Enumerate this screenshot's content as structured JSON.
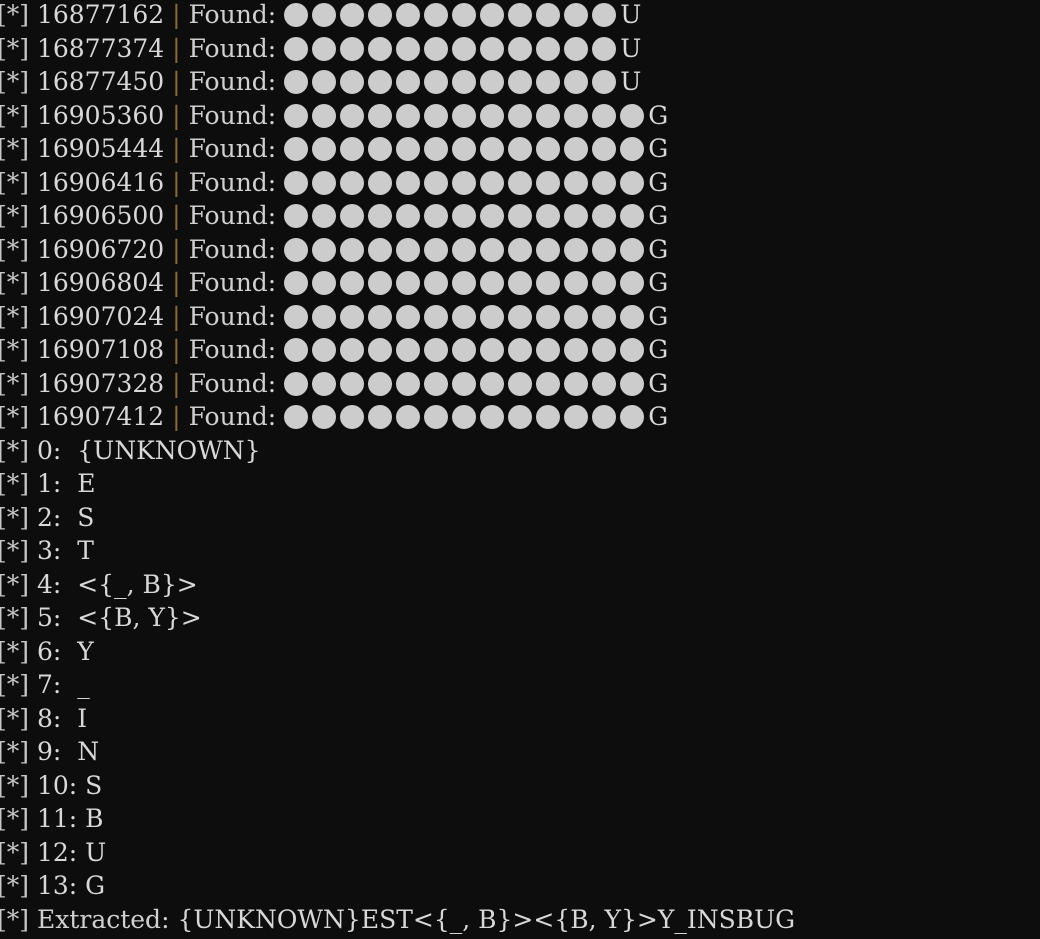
{
  "terminal": {
    "background_color": "#0d0d0d",
    "text_color": "#d4d4d4",
    "separator_color": "#8a6a3a",
    "circle_color": "#cccccc",
    "prefix": "[*]",
    "separator": "|",
    "found_label": "Found:",
    "extracted_label": "Extracted:"
  },
  "found_rows": [
    {
      "prefix": "[*]",
      "address": "16877162",
      "separator": "|",
      "label": "Found:",
      "circles": 12,
      "tail": "U"
    },
    {
      "prefix": "[*]",
      "address": "16877374",
      "separator": "|",
      "label": "Found:",
      "circles": 12,
      "tail": "U"
    },
    {
      "prefix": "[*]",
      "address": "16877450",
      "separator": "|",
      "label": "Found:",
      "circles": 12,
      "tail": "U"
    },
    {
      "prefix": "[*]",
      "address": "16905360",
      "separator": "|",
      "label": "Found:",
      "circles": 13,
      "tail": "G"
    },
    {
      "prefix": "[*]",
      "address": "16905444",
      "separator": "|",
      "label": "Found:",
      "circles": 13,
      "tail": "G"
    },
    {
      "prefix": "[*]",
      "address": "16906416",
      "separator": "|",
      "label": "Found:",
      "circles": 13,
      "tail": "G"
    },
    {
      "prefix": "[*]",
      "address": "16906500",
      "separator": "|",
      "label": "Found:",
      "circles": 13,
      "tail": "G"
    },
    {
      "prefix": "[*]",
      "address": "16906720",
      "separator": "|",
      "label": "Found:",
      "circles": 13,
      "tail": "G"
    },
    {
      "prefix": "[*]",
      "address": "16906804",
      "separator": "|",
      "label": "Found:",
      "circles": 13,
      "tail": "G"
    },
    {
      "prefix": "[*]",
      "address": "16907024",
      "separator": "|",
      "label": "Found:",
      "circles": 13,
      "tail": "G"
    },
    {
      "prefix": "[*]",
      "address": "16907108",
      "separator": "|",
      "label": "Found:",
      "circles": 13,
      "tail": "G"
    },
    {
      "prefix": "[*]",
      "address": "16907328",
      "separator": "|",
      "label": "Found:",
      "circles": 13,
      "tail": "G"
    },
    {
      "prefix": "[*]",
      "address": "16907412",
      "separator": "|",
      "label": "Found:",
      "circles": 13,
      "tail": "G"
    }
  ],
  "index_rows": [
    {
      "prefix": "[*]",
      "index": "0:",
      "value": "{UNKNOWN}"
    },
    {
      "prefix": "[*]",
      "index": "1:",
      "value": "E"
    },
    {
      "prefix": "[*]",
      "index": "2:",
      "value": "S"
    },
    {
      "prefix": "[*]",
      "index": "3:",
      "value": "T"
    },
    {
      "prefix": "[*]",
      "index": "4:",
      "value": "<{_, B}>"
    },
    {
      "prefix": "[*]",
      "index": "5:",
      "value": "<{B, Y}>"
    },
    {
      "prefix": "[*]",
      "index": "6:",
      "value": "Y"
    },
    {
      "prefix": "[*]",
      "index": "7:",
      "value": "_"
    },
    {
      "prefix": "[*]",
      "index": "8:",
      "value": "I"
    },
    {
      "prefix": "[*]",
      "index": "9:",
      "value": "N"
    },
    {
      "prefix": "[*]",
      "index": "10:",
      "value": "S"
    },
    {
      "prefix": "[*]",
      "index": "11:",
      "value": "B"
    },
    {
      "prefix": "[*]",
      "index": "12:",
      "value": "U"
    },
    {
      "prefix": "[*]",
      "index": "13:",
      "value": "G"
    }
  ],
  "extracted_row": {
    "prefix": "[*]",
    "label": "Extracted:",
    "value": "{UNKNOWN}EST<{_, B}><{B, Y}>Y_INSBUG"
  }
}
